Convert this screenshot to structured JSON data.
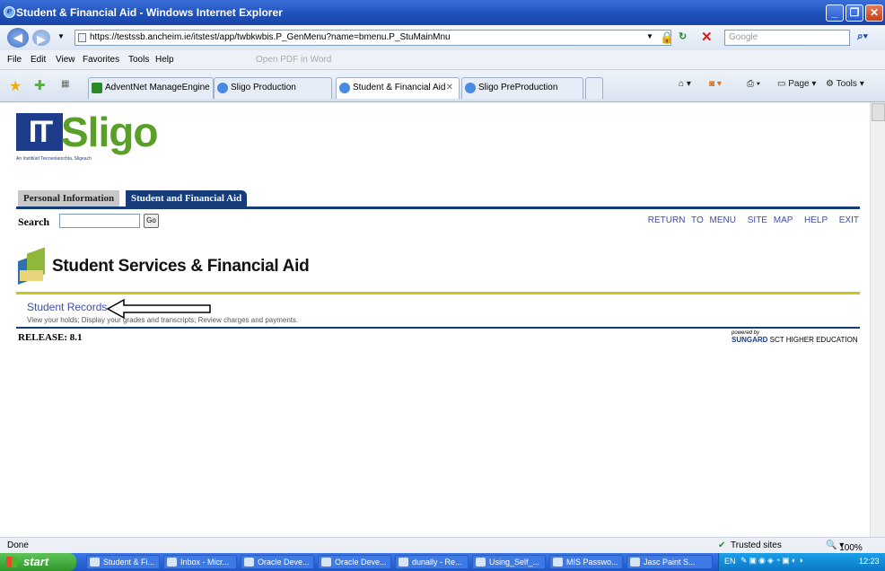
{
  "window": {
    "title": "Student & Financial Aid - Windows Internet Explorer"
  },
  "browser": {
    "url": "https://testssb.ancheim.ie/itstest/app/twbkwbis.P_GenMenu?name=bmenu.P_StuMainMnu",
    "search_placeholder": "Google",
    "menu": [
      "File",
      "Edit",
      "View",
      "Favorites",
      "Tools",
      "Help"
    ],
    "open_pdf": "Open PDF in Word",
    "tabs": [
      {
        "label": "AdventNet ManageEngine Se..."
      },
      {
        "label": "Sligo Production"
      },
      {
        "label": "Student & Financial Aid"
      },
      {
        "label": "Sligo PreProduction"
      }
    ],
    "cmd_page": "Page",
    "cmd_tools": "Tools",
    "status_left": "Done",
    "status_zone": "Trusted sites",
    "zoom": "100%"
  },
  "page": {
    "logo_it": "IT",
    "logo_sligo": "Sligo",
    "logo_sub": "An Institiúid Teicneolaíochta, Sligeach",
    "tabs": [
      "Personal Information",
      "Student and Financial Aid"
    ],
    "search_label": "Search",
    "go_label": "Go",
    "links": [
      "RETURN TO MENU",
      "SITE MAP",
      "HELP",
      "EXIT"
    ],
    "title": "Student Services & Financial Aid",
    "item_link": "Student Records",
    "item_desc": "View your holds; Display your grades and transcripts; Review charges and payments.",
    "release": "RELEASE: 8.1",
    "powered_by": "powered by",
    "sungard_a": "SUNGARD",
    "sungard_b": " SCT HIGHER EDUCATION"
  },
  "taskbar": {
    "start": "start",
    "items": [
      "Student & Fi...",
      "Inbox - Micr...",
      "Oracle Deve...",
      "Oracle Deve...",
      "dunally - Re...",
      "Using_Self_...",
      "MIS Passwo...",
      "Jasc Paint S..."
    ],
    "lang": "EN",
    "clock": "12:23"
  }
}
